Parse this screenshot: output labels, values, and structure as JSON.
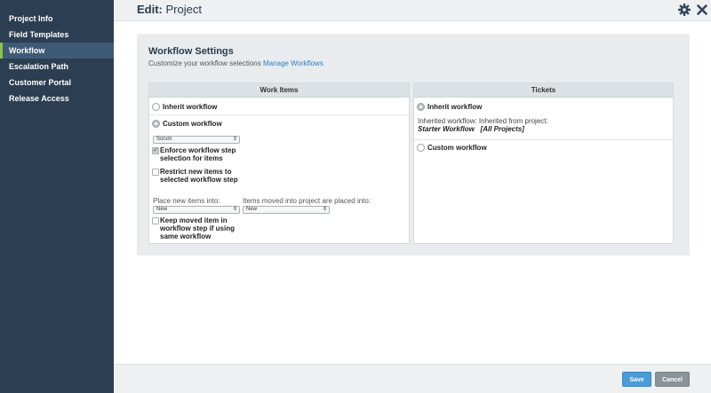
{
  "sidebar": {
    "items": [
      {
        "label": "Project Info"
      },
      {
        "label": "Field Templates"
      },
      {
        "label": "Workflow"
      },
      {
        "label": "Escalation Path"
      },
      {
        "label": "Customer Portal"
      },
      {
        "label": "Release Access"
      }
    ],
    "active_index": 2
  },
  "header": {
    "title_prefix": "Edit:",
    "title": "Project",
    "icons": [
      "gear-icon",
      "close-icon"
    ]
  },
  "panel": {
    "title": "Workflow Settings",
    "subtitle": "Customize your workflow selections",
    "manage_link": "Manage Workflows"
  },
  "work_items": {
    "header": "Work Items",
    "inherit_label": "Inherit workflow",
    "custom_label": "Custom workflow",
    "workflow_select": "Scrum",
    "enforce_label": "Enforce workflow step selection for items",
    "restrict_label": "Restrict new items to selected workflow step",
    "place_new_label": "Place new items into:",
    "place_new_value": "New",
    "moved_label": "Items moved into project are placed into:",
    "moved_value": "New",
    "keep_moved_label": "Keep moved item in workflow step if using same workflow"
  },
  "tickets": {
    "header": "Tickets",
    "inherit_label": "Inherit workflow",
    "inherited_from": "Inherited workflow: Inherited from project:",
    "inherited_workflow": "Starter Workflow",
    "inherited_project": "[All Projects]",
    "custom_label": "Custom workflow"
  },
  "footer": {
    "save_label": "Save",
    "cancel_label": "Cancel"
  },
  "colors": {
    "sidebar_bg": "#2c3e52",
    "active_accent": "#8bc34a",
    "link": "#2a7fc4",
    "save": "#4a9bd6",
    "cancel": "#8a9397"
  }
}
